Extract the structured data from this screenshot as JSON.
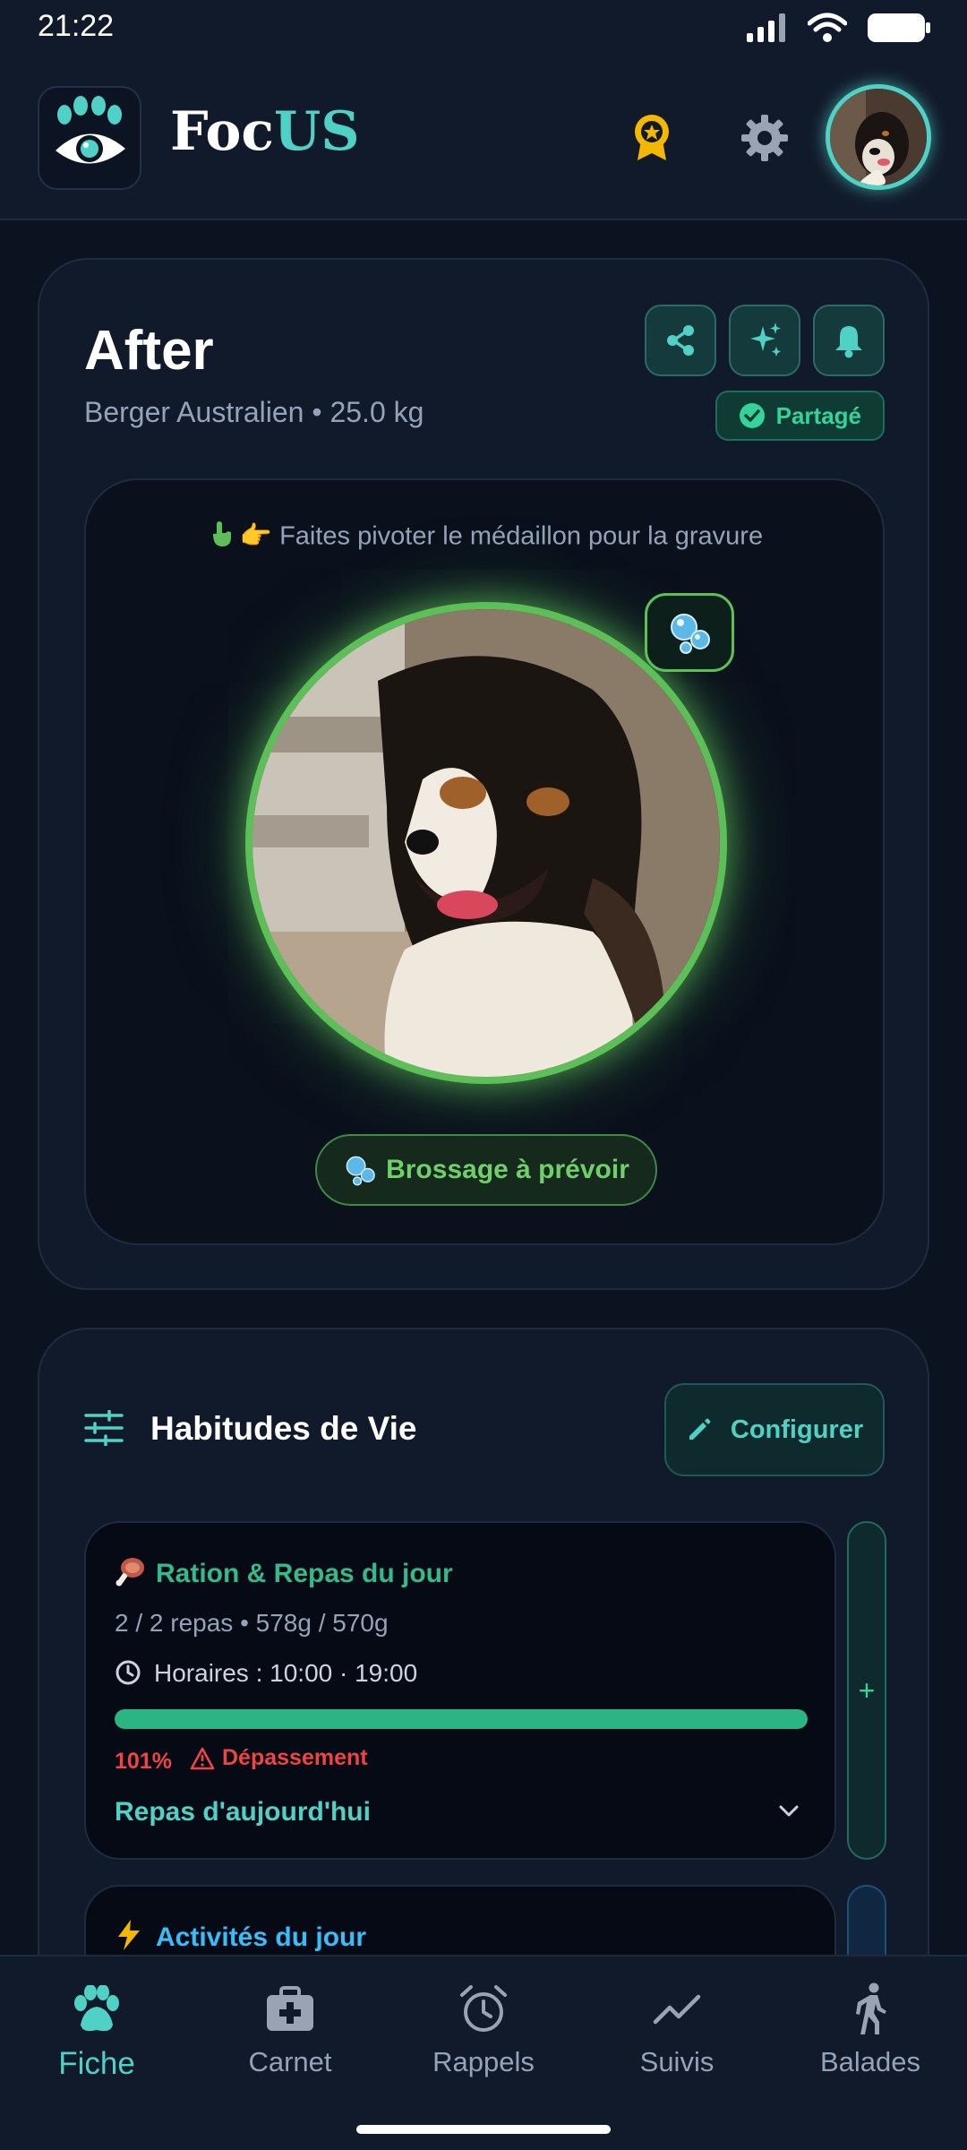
{
  "status_bar": {
    "time": "21:22"
  },
  "header": {
    "brand_white": "Foc",
    "brand_accent": "US",
    "icons": [
      "paw-eye-logo-icon",
      "award-badge-icon",
      "gear-icon",
      "avatar"
    ]
  },
  "pet": {
    "name": "After",
    "subtitle": "Berger Australien • 25.0 kg",
    "shared_label": "Partagé",
    "actions": [
      "share-icon",
      "sparkles-icon",
      "bell-icon"
    ],
    "medal_hint": "👉 Faites pivoter le médaillon pour la gravure",
    "brush_label": "Brossage à prévoir"
  },
  "habits": {
    "title": "Habitudes de Vie",
    "configure_label": "Configurer",
    "meal": {
      "title": "Ration & Repas du jour",
      "count": "2 / 2 repas • 578g / 570g",
      "hours": "Horaires : 10:00 · 19:00",
      "progress": 1.01,
      "percent": "101%",
      "overflow": "Dépassement",
      "today_label": "Repas d'aujourd'hui",
      "add": "+"
    },
    "activity": {
      "title": "Activités du jour"
    }
  },
  "nav": {
    "items": [
      {
        "label": "Fiche",
        "icon": "paw-icon",
        "active": true
      },
      {
        "label": "Carnet",
        "icon": "medical-kit-icon",
        "active": false
      },
      {
        "label": "Rappels",
        "icon": "alarm-clock-icon",
        "active": false
      },
      {
        "label": "Suivis",
        "icon": "trend-line-icon",
        "active": false
      },
      {
        "label": "Balades",
        "icon": "walking-icon",
        "active": false
      }
    ]
  },
  "colors": {
    "accent": "#4fd1c5",
    "green": "#5cbf58",
    "danger": "#ef4444",
    "background": "#0b1220"
  }
}
